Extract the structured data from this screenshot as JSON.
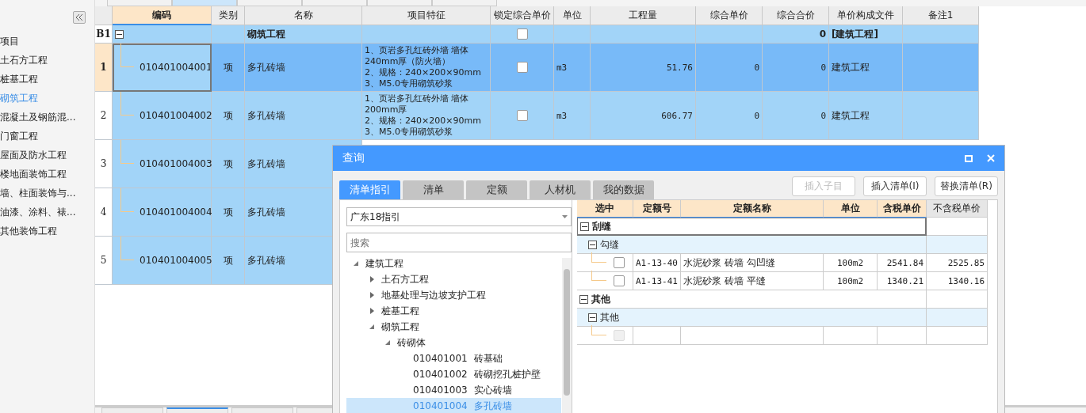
{
  "top_tabs": [
    {
      "selected": false
    },
    {
      "selected": true
    },
    {
      "selected": false
    },
    {
      "selected": false
    },
    {
      "selected": false
    },
    {
      "selected": false
    }
  ],
  "sidebar": {
    "items": [
      {
        "label": "项目",
        "selected": false
      },
      {
        "label": "土石方工程",
        "selected": false
      },
      {
        "label": "桩基工程",
        "selected": false
      },
      {
        "label": "砌筑工程",
        "selected": true
      },
      {
        "label": "混凝土及钢筋混...",
        "selected": false
      },
      {
        "label": "门窗工程",
        "selected": false
      },
      {
        "label": "屋面及防水工程",
        "selected": false
      },
      {
        "label": "楼地面装饰工程",
        "selected": false
      },
      {
        "label": "墙、柱面装饰与...",
        "selected": false
      },
      {
        "label": "油漆、涂料、裱...",
        "selected": false
      },
      {
        "label": "其他装饰工程",
        "selected": false
      }
    ]
  },
  "table": {
    "columns": [
      "编码",
      "类别",
      "名称",
      "项目特征",
      "锁定综合单价",
      "单位",
      "工程量",
      "综合单价",
      "综合合价",
      "单价构成文件",
      "备注1"
    ],
    "group": {
      "number": "B1",
      "expanded": true,
      "name": "砌筑工程",
      "locked": false,
      "total": "0",
      "file": "[建筑工程]"
    },
    "rows": [
      {
        "number": "1",
        "selected": true,
        "code": "010401004001",
        "type": "项",
        "name": "多孔砖墙",
        "features": [
          "1、页岩多孔红砖外墙 墙体",
          "240mm厚（防火墙）",
          "2、规格：240×200×90mm",
          "3、M5.0专用砌筑砂浆"
        ],
        "locked": false,
        "unit": "m3",
        "quantity": "51.76",
        "unit_price": "0",
        "total": "0",
        "file": "建筑工程"
      },
      {
        "number": "2",
        "selected": false,
        "code": "010401004002",
        "type": "项",
        "name": "多孔砖墙",
        "features": [
          "1、页岩多孔红砖外墙 墙体",
          "200mm厚",
          "2、规格：240×200×90mm",
          "3、M5.0专用砌筑砂浆"
        ],
        "locked": false,
        "unit": "m3",
        "quantity": "606.77",
        "unit_price": "0",
        "total": "0",
        "file": "建筑工程"
      },
      {
        "number": "3",
        "selected": false,
        "code": "010401004003",
        "type": "项",
        "name": "多孔砖墙"
      },
      {
        "number": "4",
        "selected": false,
        "code": "010401004004",
        "type": "项",
        "name": "多孔砖墙"
      },
      {
        "number": "5",
        "selected": false,
        "code": "010401004005",
        "type": "项",
        "name": "多孔砖墙"
      }
    ]
  },
  "bottom_tabs": [
    {
      "selected": false
    },
    {
      "selected": true
    },
    {
      "selected": false
    },
    {
      "selected": false
    }
  ],
  "dialog": {
    "title": "查询",
    "tabs": [
      {
        "label": "清单指引",
        "selected": true
      },
      {
        "label": "清单",
        "selected": false
      },
      {
        "label": "定额",
        "selected": false
      },
      {
        "label": "人材机",
        "selected": false
      },
      {
        "label": "我的数据",
        "selected": false
      }
    ],
    "buttons": [
      {
        "label": "插入子目",
        "disabled": true
      },
      {
        "label": "插入清单(I)",
        "disabled": false
      },
      {
        "label": "替换清单(R)",
        "disabled": false
      }
    ],
    "guide_select": "广东18指引",
    "search": {
      "placeholder": "搜索"
    },
    "tree": [
      {
        "label": "建筑工程",
        "expanded": true,
        "children": [
          {
            "label": "土石方工程",
            "expanded": false
          },
          {
            "label": "地基处理与边坡支护工程",
            "expanded": false
          },
          {
            "label": "桩基工程",
            "expanded": false
          },
          {
            "label": "砌筑工程",
            "expanded": true,
            "children": [
              {
                "label": "砖砌体",
                "expanded": true,
                "children": [
                  {
                    "code": "010401001",
                    "label": "砖基础",
                    "selected": false
                  },
                  {
                    "code": "010401002",
                    "label": "砖砌挖孔桩护壁",
                    "selected": false
                  },
                  {
                    "code": "010401003",
                    "label": "实心砖墙",
                    "selected": false
                  },
                  {
                    "code": "010401004",
                    "label": "多孔砖墙",
                    "selected": true
                  }
                ]
              }
            ]
          }
        ]
      }
    ],
    "grid": {
      "columns": [
        "选中",
        "定额号",
        "定额名称",
        "单位",
        "含税单价",
        "不含税单价"
      ],
      "groups": [
        {
          "name": "刮缝",
          "expanded": true,
          "children": [
            {
              "name": "勾缝",
              "expanded": true,
              "items": [
                {
                  "checked": false,
                  "disabled": false,
                  "code": "A1-13-40",
                  "name": "水泥砂浆 砖墙 勾凹缝",
                  "unit": "100m2",
                  "tax_price": "2541.84",
                  "price": "2525.85"
                },
                {
                  "checked": false,
                  "disabled": false,
                  "code": "A1-13-41",
                  "name": "水泥砂浆 砖墙 平缝",
                  "unit": "100m2",
                  "tax_price": "1340.21",
                  "price": "1340.16"
                }
              ]
            }
          ]
        },
        {
          "name": "其他",
          "expanded": true,
          "children": [
            {
              "name": "其他",
              "expanded": true,
              "items": [
                {
                  "checked": false,
                  "disabled": true
                }
              ]
            }
          ]
        }
      ]
    }
  }
}
